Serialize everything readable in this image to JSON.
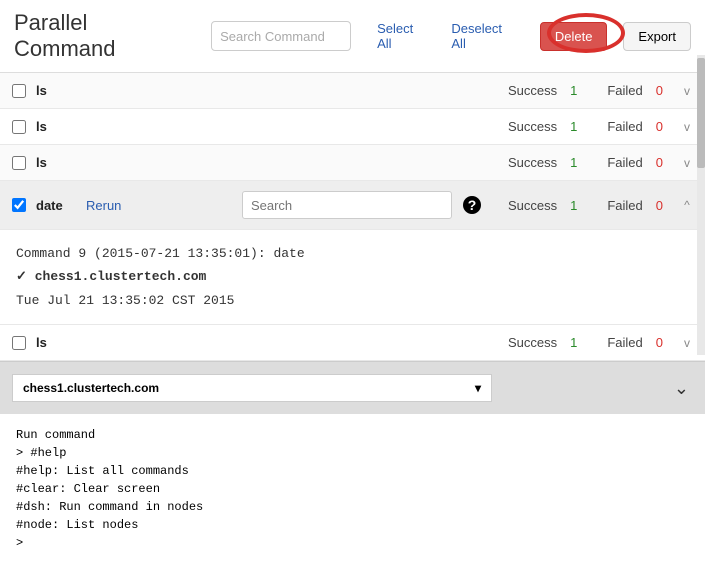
{
  "header": {
    "title": "Parallel Command",
    "search_placeholder": "Search Command",
    "select_all": "Select All",
    "deselect_all": "Deselect All",
    "delete": "Delete",
    "export": "Export"
  },
  "labels": {
    "success": "Success",
    "failed": "Failed",
    "rerun": "Rerun",
    "search_placeholder": "Search",
    "caret_collapsed": "v",
    "caret_expanded": "^"
  },
  "rows": [
    {
      "cmd": "ls",
      "checked": false,
      "success": 1,
      "failed": 0,
      "expanded": false
    },
    {
      "cmd": "ls",
      "checked": false,
      "success": 1,
      "failed": 0,
      "expanded": false
    },
    {
      "cmd": "ls",
      "checked": false,
      "success": 1,
      "failed": 0,
      "expanded": false
    },
    {
      "cmd": "date",
      "checked": true,
      "success": 1,
      "failed": 0,
      "expanded": true
    },
    {
      "cmd": "ls",
      "checked": false,
      "success": 1,
      "failed": 0,
      "expanded": false
    }
  ],
  "detail": {
    "header_line": "Command 9 (2015-07-21 13:35:01):  date",
    "check_mark": "✓",
    "host": "chess1.clustertech.com",
    "output": "Tue Jul 21 13:35:02 CST 2015"
  },
  "bottom": {
    "host_selected": "chess1.clustertech.com",
    "terminal_lines": "Run command\n> #help\n#help: List all commands\n#clear: Clear screen\n#dsh: Run command in nodes\n#node: List nodes\n>"
  }
}
